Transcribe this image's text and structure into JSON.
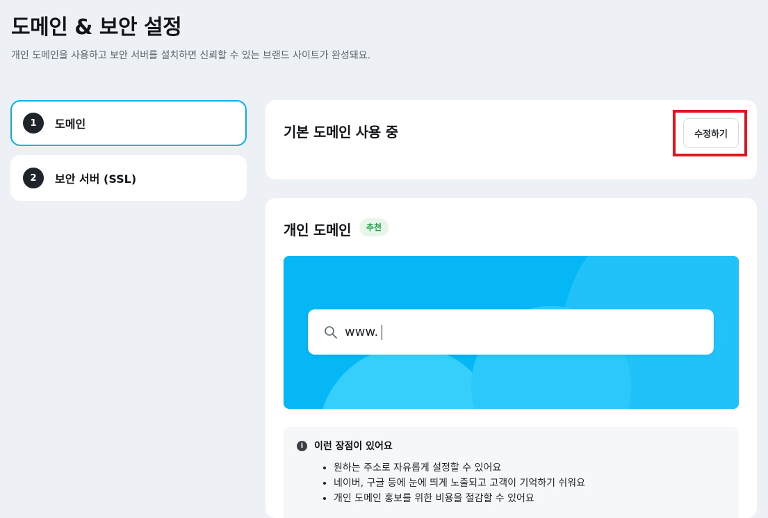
{
  "page": {
    "title": "도메인 & 보안 설정",
    "subtitle": "개인 도메인을 사용하고 보안 서버를 설치하면 신뢰할 수 있는 브랜드 사이트가 완성돼요."
  },
  "steps": [
    {
      "number": "1",
      "label": "도메인",
      "active": true
    },
    {
      "number": "2",
      "label": "보안 서버 (SSL)",
      "active": false
    }
  ],
  "default_domain": {
    "title": "기본 도메인 사용 중",
    "edit_label": "수정하기"
  },
  "custom_domain": {
    "title": "개인 도메인",
    "badge": "추천",
    "search": {
      "icon": "search-icon",
      "prefix": "www.",
      "value": ""
    },
    "info": {
      "icon": "info-icon",
      "icon_glyph": "i",
      "heading": "이런 장점이 있어요",
      "benefits": [
        "원하는 주소로 자유롭게 설정할 수 있어요",
        "네이버, 구글 등에 눈에 띄게 노출되고 고객이 기억하기 쉬워요",
        "개인 도메인 홍보를 위한 비용을 절감할 수 있어요"
      ]
    }
  },
  "colors": {
    "background": "#edf0f4",
    "accent": "#00b2e6",
    "highlight": "#e3151a",
    "banner": "#05b7f5",
    "badge_text": "#21a24a",
    "badge_bg": "#e6f7ea"
  }
}
